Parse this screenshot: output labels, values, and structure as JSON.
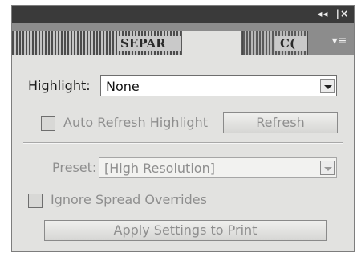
{
  "titlebar": {
    "collapse_glyph": "◂◂",
    "close_glyph": "|×",
    "icons": [
      "collapse-icon",
      "close-icon"
    ]
  },
  "tabs": [
    {
      "label": "SEPAR",
      "state": "inactive"
    },
    {
      "label": "",
      "state": "active"
    },
    {
      "label": "C(",
      "state": "inactive"
    }
  ],
  "panel_menu": {
    "glyph": "▾≡",
    "icon": "panel-menu-icon"
  },
  "highlight": {
    "label": "Highlight:",
    "value": "None"
  },
  "auto_refresh": {
    "label": "Auto Refresh Highlight",
    "checked": false
  },
  "refresh_button": {
    "label": "Refresh"
  },
  "preset": {
    "label": "Preset:",
    "value": "[High Resolution]"
  },
  "ignore_spread": {
    "label": "Ignore Spread Overrides",
    "checked": false
  },
  "apply_button": {
    "label": "Apply Settings to Print"
  },
  "colors": {
    "panel_bg": "#e2e2e0",
    "titlebar_bg": "#3a3a3a",
    "disabled_text": "#8e8e8e"
  }
}
